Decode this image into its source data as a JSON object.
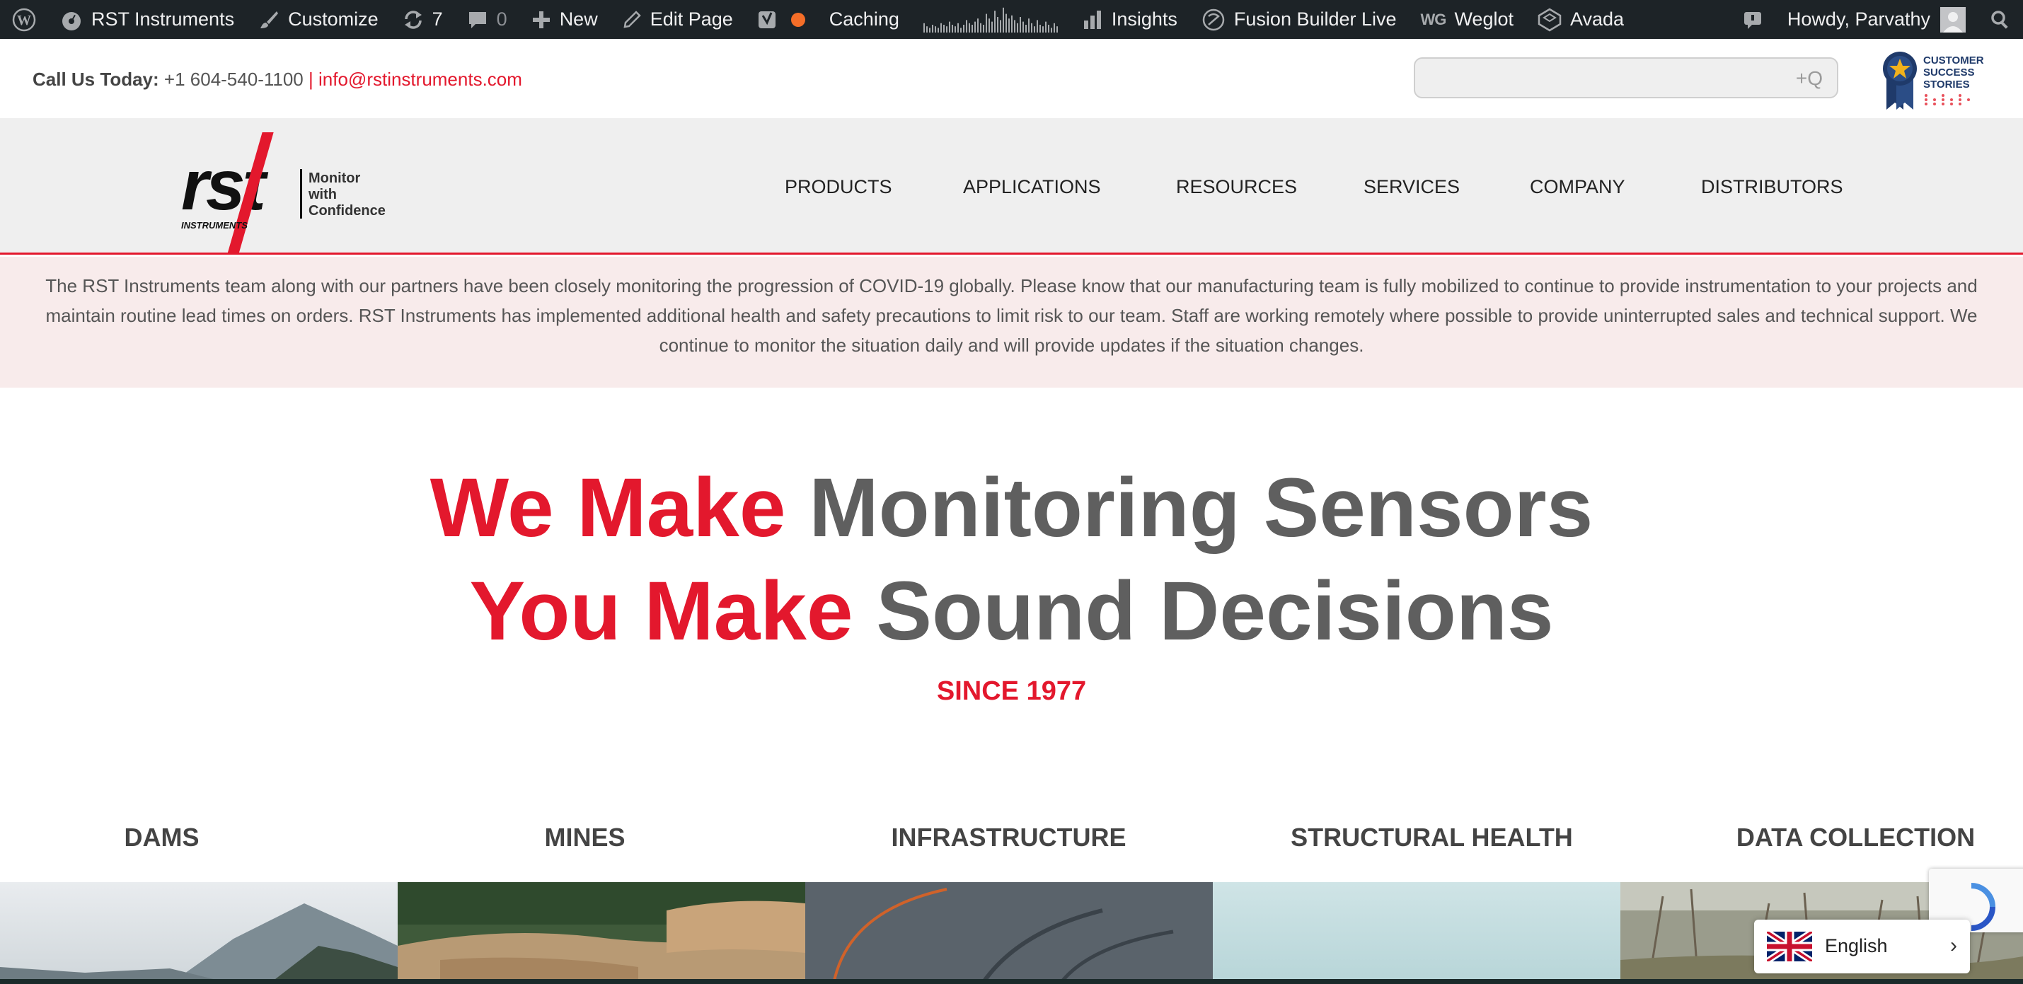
{
  "admin_bar": {
    "site_name": "RST Instruments",
    "customize": "Customize",
    "updates_count": "7",
    "comments_count": "0",
    "new": "New",
    "edit_page": "Edit Page",
    "caching": "Caching",
    "insights": "Insights",
    "fusion_builder": "Fusion Builder Live",
    "weglot_abbr": "WG",
    "weglot": "Weglot",
    "avada": "Avada",
    "howdy": "Howdy, Parvathy"
  },
  "topbar": {
    "call_label": "Call Us Today:",
    "phone": "+1 604-540-1100",
    "separator": "|",
    "email": "info@rstinstruments.com",
    "search_icon": "search-plus-icon",
    "badge_line1": "CUSTOMER",
    "badge_line2": "SUCCESS",
    "badge_line3": "STORIES"
  },
  "logo": {
    "wordmark": "rst",
    "subword": "INSTRUMENTS",
    "tagline1": "Monitor",
    "tagline2": "with",
    "tagline3": "Confidence"
  },
  "nav": {
    "items": [
      "PRODUCTS",
      "APPLICATIONS",
      "RESOURCES",
      "SERVICES",
      "COMPANY",
      "DISTRIBUTORS"
    ]
  },
  "notice": {
    "text": "The RST Instruments team along with our partners have been closely monitoring the progression of COVID-19 globally. Please know that our manufacturing team is fully mobilized to continue to provide instrumentation to your projects and maintain routine lead times on orders. RST Instruments has implemented additional health and safety precautions to limit risk to our team. Staff are working remotely where possible to provide uninterrupted sales and technical support. We continue to monitor the situation daily and will provide updates if the situation changes."
  },
  "hero": {
    "line1_red": "We Make",
    "line1_grey": "Monitoring Sensors",
    "line2_red": "You Make",
    "line2_grey": "Sound Decisions",
    "since": "SINCE 1977"
  },
  "categories": [
    "DAMS",
    "MINES",
    "INFRASTRUCTURE",
    "STRUCTURAL HEALTH",
    "DATA COLLECTION"
  ],
  "language": {
    "name": "English",
    "chevron": "›"
  },
  "colors": {
    "brand_red": "#e3182d",
    "admin_bar_bg": "#1d2327",
    "header_bg": "#efefef",
    "notice_bg": "#f8ebeb",
    "hero_grey": "#5f5f5f"
  }
}
